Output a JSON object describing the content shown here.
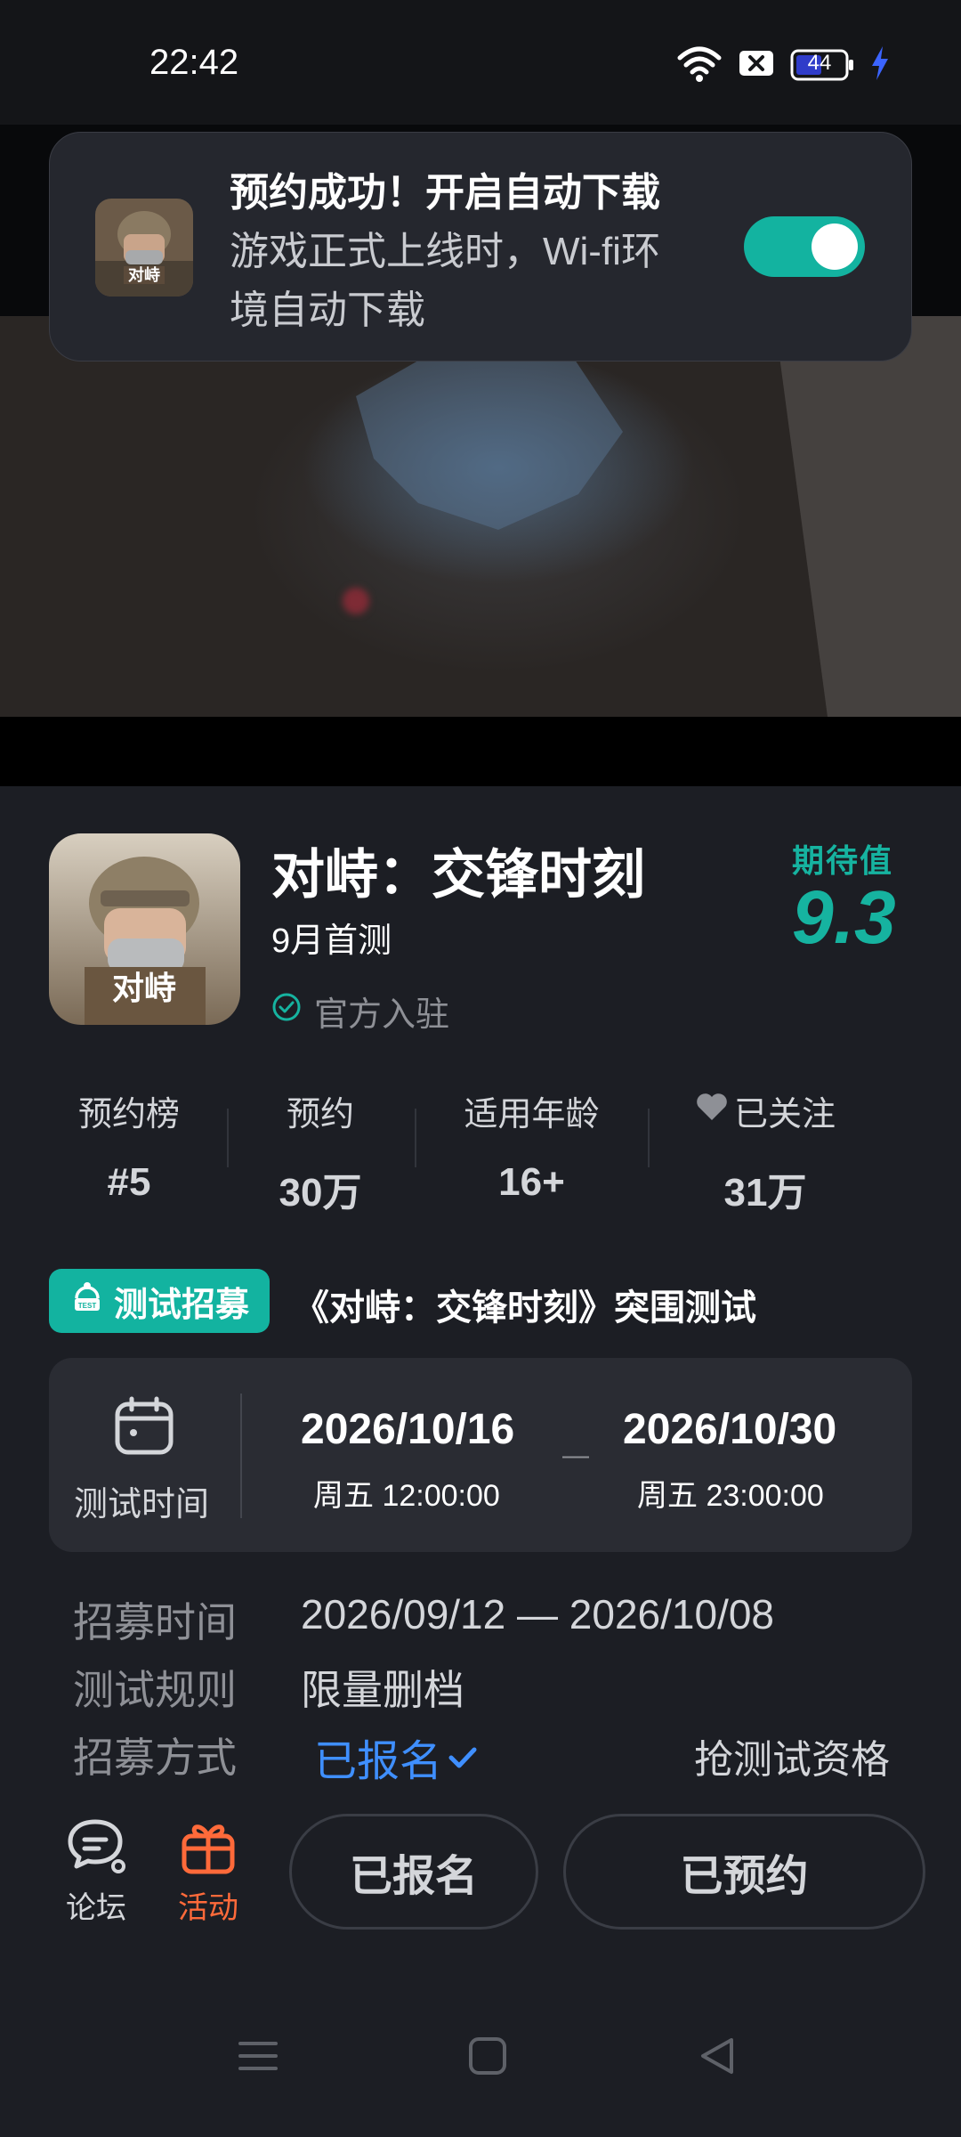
{
  "status_bar": {
    "time": "22:42",
    "battery": "44"
  },
  "toast": {
    "title": "预约成功！开启自动下载",
    "description": "游戏正式上线时，Wi-fi环境自动下载",
    "toggle_on": true
  },
  "game": {
    "title": "对峙：交锋时刻",
    "subtitle": "9月首测",
    "official": "官方入驻",
    "expectation_label": "期待值",
    "expectation_value": "9.3",
    "icon_text": "对峙"
  },
  "stats": [
    {
      "label": "预约榜",
      "value": "#5"
    },
    {
      "label": "预约",
      "value": "30万"
    },
    {
      "label": "适用年龄",
      "value": "16+"
    },
    {
      "label": "已关注",
      "value": "31万"
    }
  ],
  "recruit": {
    "badge": "测试招募",
    "title": "《对峙：交锋时刻》突围测试",
    "test_time_label": "测试时间",
    "start_date": "2026/10/16",
    "start_weekday_time": "周五  12:00:00",
    "end_date": "2026/10/30",
    "end_weekday_time": "周五  23:00:00",
    "separator": "—",
    "rows": [
      {
        "label": "招募时间",
        "value": "2026/09/12 — 2026/10/08"
      },
      {
        "label": "测试规则",
        "value": "限量删档"
      },
      {
        "label": "招募方式",
        "value": "已报名"
      }
    ],
    "grab_label": "抢测试资格"
  },
  "bottom_bar": {
    "forum_label": "论坛",
    "activity_label": "活动",
    "registered_button": "已报名",
    "reserved_button": "已预约"
  },
  "colors": {
    "accent": "#13b3a0",
    "link": "#3f8fff",
    "activity": "#ff6a3a"
  }
}
